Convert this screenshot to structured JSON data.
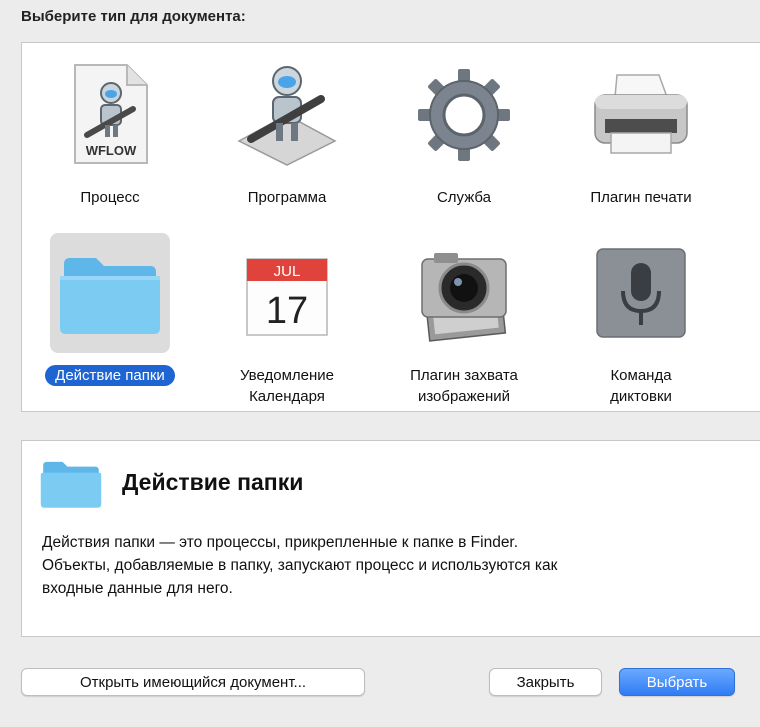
{
  "heading": "Выберите тип для документа:",
  "tiles": [
    {
      "label": "Процесс",
      "icon": "workflow-file-icon",
      "badge": "WFLOW"
    },
    {
      "label": "Программа",
      "icon": "automator-robot-icon"
    },
    {
      "label": "Служба",
      "icon": "gear-icon"
    },
    {
      "label": "Плагин печати",
      "icon": "printer-icon"
    },
    {
      "label": "Действие папки",
      "icon": "folder-icon",
      "selected": true
    },
    {
      "label": "Уведомление\nКалендаря",
      "icon": "calendar-icon",
      "month": "JUL",
      "day": "17"
    },
    {
      "label": "Плагин захвата\nизображений",
      "icon": "camera-icon"
    },
    {
      "label": "Команда\nдиктовки",
      "icon": "microphone-icon"
    }
  ],
  "description": {
    "title": "Действие папки",
    "text": "Действия папки — это процессы, прикрепленные к папке в Finder.\nОбъекты, добавляемые в папку, запускают процесс и используются как\nвходные данные для него."
  },
  "buttons": {
    "open_existing": "Открыть имеющийся документ...",
    "close": "Закрыть",
    "choose": "Выбрать"
  },
  "colors": {
    "selection": "#1e64d2",
    "folder": "#6fc4f0",
    "primary_button": "#2f7cf4",
    "calendar_red": "#e0433b"
  }
}
